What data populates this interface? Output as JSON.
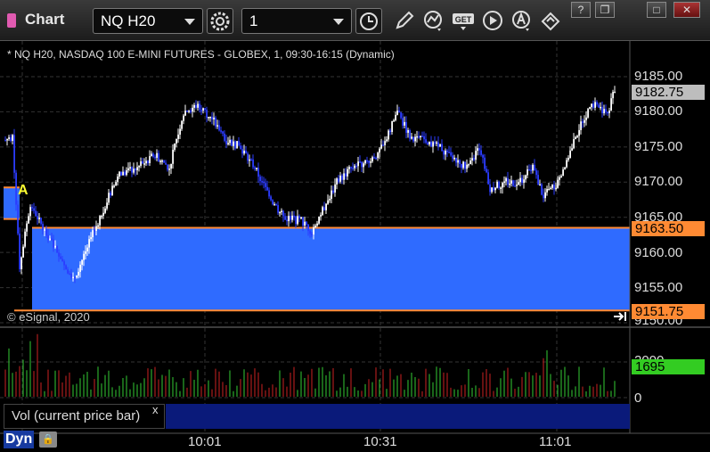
{
  "window": {
    "title": "Chart",
    "symbol_select": "NQ H20",
    "interval_select": "1",
    "window_buttons": [
      "?",
      "❐",
      "□",
      "✕"
    ]
  },
  "chart": {
    "series_info": "* NQ H20, NASDAQ 100 E-MINI FUTURES - GLOBEX, 1, 09:30-16:15 (Dynamic)",
    "copyright": "© eSignal, 2020",
    "marker": "A",
    "price_axis": [
      "9185.00",
      "9180.00",
      "9175.00",
      "9170.00",
      "9165.00",
      "9160.00",
      "9155.00",
      "9150.00"
    ],
    "last_price": "9182.75",
    "upper_band": "9163.50",
    "lower_band": "9151.75",
    "time_axis": [
      "10:01",
      "10:31",
      "11:01"
    ],
    "colors": {
      "background": "#000000",
      "band": "#2f6bff",
      "band_edge": "#ff8a33",
      "up_bar": "#ffffff",
      "down_bar": "#2b3cff",
      "volume_up": "#33cc33",
      "volume_down": "#cc2222",
      "volume_badge": "#33cc22"
    }
  },
  "volume": {
    "label": "Vol (current price bar)",
    "close_symbol": "x",
    "value": "1695",
    "axis": [
      "2000",
      "0"
    ]
  },
  "status": {
    "mode": "Dyn"
  }
}
